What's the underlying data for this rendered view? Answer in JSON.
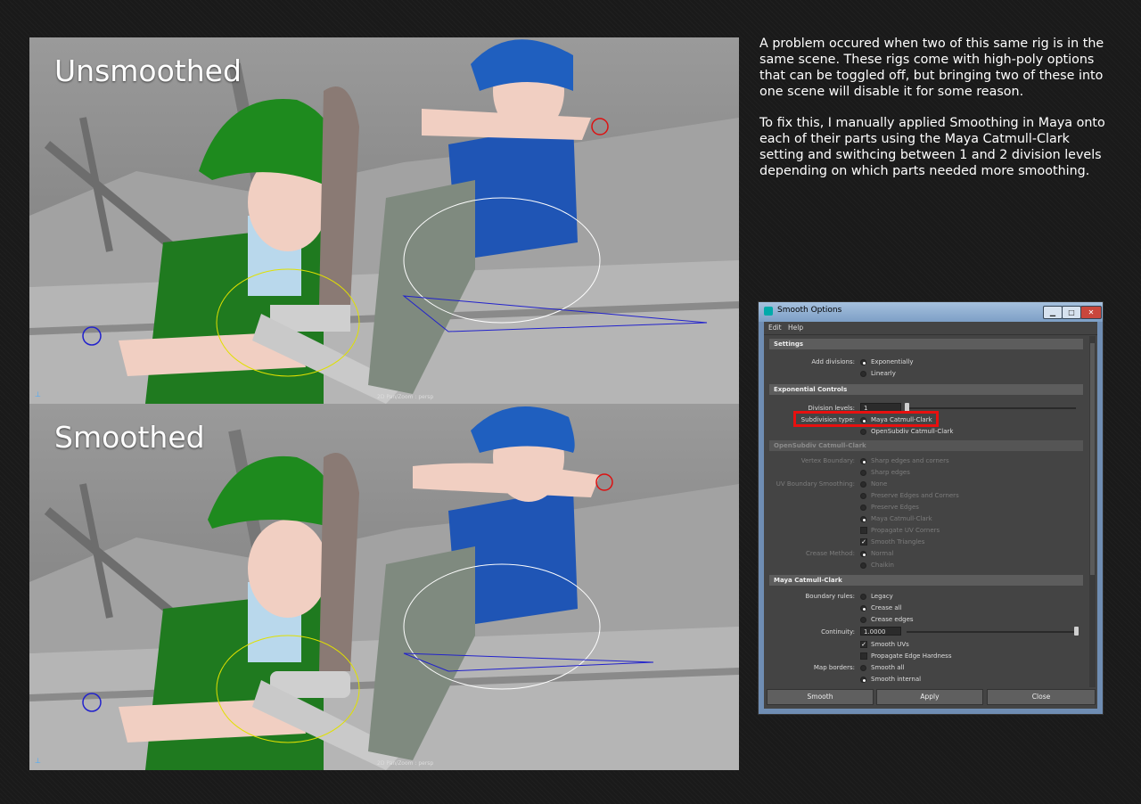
{
  "viewports": [
    {
      "label": "Unsmoothed",
      "hud": "2D Pan/Zoom : persp"
    },
    {
      "label": "Smoothed",
      "hud": "2D Pan/Zoom : persp"
    }
  ],
  "description": {
    "paragraph1": "A problem occured when two of this same rig is in the same scene. These rigs come with high-poly options that can be toggled off, but bringing two of these into one scene will disable it for some reason.",
    "paragraph2": "To fix this, I manually applied Smoothing in Maya onto each of their parts using the Maya Catmull-Clark setting and swithcing between 1 and 2 division levels depending on which parts needed more smoothing."
  },
  "dialog": {
    "title": "Smooth Options",
    "menu": [
      "Edit",
      "Help"
    ],
    "sections": {
      "settings": "Settings",
      "exponential": "Exponential Controls",
      "opensubdiv": "OpenSubdiv Catmull-Clark",
      "maya_cc": "Maya Catmull-Clark"
    },
    "add_divisions": {
      "label": "Add divisions:",
      "options": [
        "Exponentially",
        "Linearly"
      ],
      "selected": 0
    },
    "division_levels": {
      "label": "Division levels:",
      "value": "1"
    },
    "subdivision_type": {
      "label": "Subdivision type:",
      "options": [
        "Maya Catmull-Clark",
        "OpenSubdiv Catmull-Clark"
      ],
      "selected": 0
    },
    "vertex_boundary": {
      "label": "Vertex Boundary:",
      "options": [
        "Sharp edges and corners",
        "Sharp edges"
      ]
    },
    "uv_boundary": {
      "label": "UV Boundary Smoothing:",
      "options": [
        "None",
        "Preserve Edges and Corners",
        "Preserve Edges",
        "Maya Catmull-Clark"
      ]
    },
    "propagate_uv_corners": "Propagate UV Corners",
    "smooth_triangles": "Smooth Triangles",
    "crease_method": {
      "label": "Crease Method:",
      "options": [
        "Normal",
        "Chaikin"
      ]
    },
    "boundary_rules": {
      "label": "Boundary rules:",
      "options": [
        "Legacy",
        "Crease all",
        "Crease edges"
      ],
      "selected": 1
    },
    "continuity": {
      "label": "Continuity:",
      "value": "1.0000"
    },
    "smooth_uvs": "Smooth UVs",
    "propagate_edge_hardness": "Propagate Edge Hardness",
    "map_borders": {
      "label": "Map borders:",
      "options": [
        "Smooth all",
        "Smooth internal"
      ],
      "selected": 1
    },
    "buttons": {
      "smooth": "Smooth",
      "apply": "Apply",
      "close": "Close"
    },
    "window_buttons": {
      "minimize": "▁",
      "maximize": "□",
      "close": "✕"
    }
  },
  "colors": {
    "highlight": "#e8100f",
    "helmet_green": "#1e8a1e",
    "helmet_blue": "#1f5fbf"
  }
}
